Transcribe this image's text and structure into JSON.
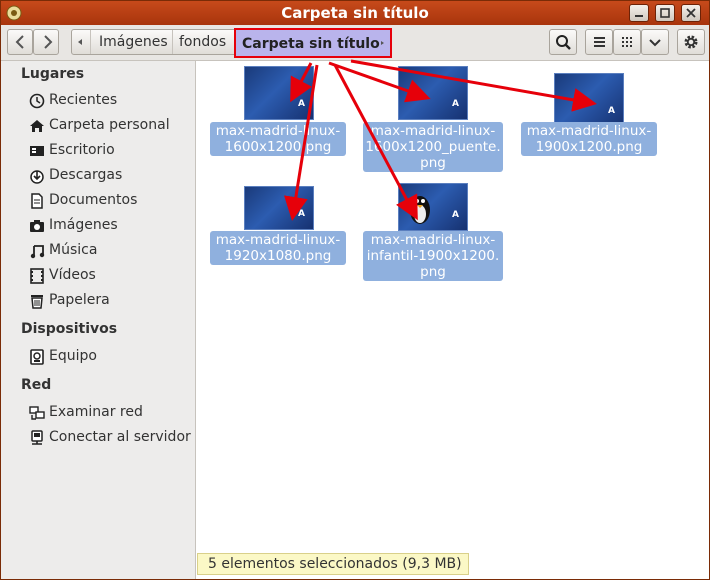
{
  "window": {
    "title": "Carpeta sin título"
  },
  "breadcrumb": {
    "items": [
      "Imágenes",
      "fondos"
    ],
    "active": "Carpeta sin título"
  },
  "sidebar": {
    "sections": [
      {
        "heading": "Lugares",
        "items": [
          {
            "label": "Recientes",
            "icon": "clock-icon"
          },
          {
            "label": "Carpeta personal",
            "icon": "home-icon"
          },
          {
            "label": "Escritorio",
            "icon": "desktop-icon"
          },
          {
            "label": "Descargas",
            "icon": "download-icon"
          },
          {
            "label": "Documentos",
            "icon": "document-icon"
          },
          {
            "label": "Imágenes",
            "icon": "camera-icon"
          },
          {
            "label": "Música",
            "icon": "music-icon"
          },
          {
            "label": "Vídeos",
            "icon": "film-icon"
          },
          {
            "label": "Papelera",
            "icon": "trash-icon"
          }
        ]
      },
      {
        "heading": "Dispositivos",
        "items": [
          {
            "label": "Equipo",
            "icon": "computer-icon"
          }
        ]
      },
      {
        "heading": "Red",
        "items": [
          {
            "label": "Examinar red",
            "icon": "network-icon"
          },
          {
            "label": "Conectar al servidor",
            "icon": "server-icon"
          }
        ]
      }
    ]
  },
  "files": [
    {
      "name_line1": "max-madrid-linux-",
      "name_line2": "1600x1200.png",
      "name_line3": ""
    },
    {
      "name_line1": "max-madrid-linux-",
      "name_line2": "1600x1200_puente.",
      "name_line3": "png"
    },
    {
      "name_line1": "max-madrid-linux-",
      "name_line2": "1900x1200.png",
      "name_line3": ""
    },
    {
      "name_line1": "max-madrid-linux-",
      "name_line2": "1920x1080.png",
      "name_line3": ""
    },
    {
      "name_line1": "max-madrid-linux-",
      "name_line2": "infantil-1900x1200.",
      "name_line3": "png"
    }
  ],
  "status": {
    "text": "5 elementos seleccionados  (9,3 MB)"
  },
  "colors": {
    "titlebar": "#b83e12",
    "selection": "#8fb0de",
    "annotation_arrow": "#e6000a",
    "active_crumb": "#b9b4ec"
  }
}
